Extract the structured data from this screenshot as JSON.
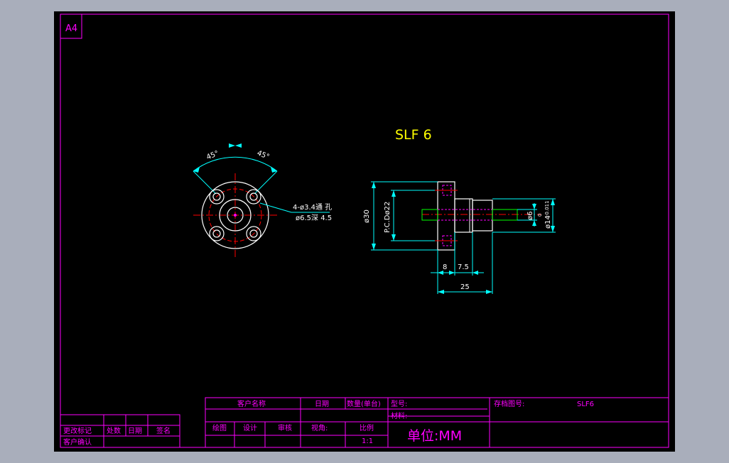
{
  "sheet": {
    "size_label": "A4"
  },
  "title": "SLF 6",
  "front_view": {
    "angle_left": "45°",
    "angle_right": "45°",
    "hole_note_line1": "4-ø3.4通 孔",
    "hole_note_line2": "ø6.5深 4.5"
  },
  "side_view": {
    "dim_outer_dia": "ø30",
    "dim_pcd": "P.C.Dø22",
    "dim_shaft_dia": "ø6",
    "dim_body_dia": "ø14",
    "dim_body_tol_upper": "0",
    "dim_body_tol_lower": "-0.011",
    "dim_flange": "8",
    "dim_step": "7.5",
    "dim_length": "25"
  },
  "title_block": {
    "customer_name_label": "客户名称",
    "date_label": "日期",
    "qty_label": "数量(单台)",
    "model_label": "型号:",
    "archive_label": "存档图号:",
    "archive_value": "SLF6",
    "material_label": "材料:",
    "drawn_label": "绘图",
    "design_label": "设计",
    "review_label": "审核",
    "view_label": "视角:",
    "scale_label": "比例",
    "scale_value": "1:1",
    "unit_label": "单位:MM"
  },
  "revision_block": {
    "change_mark": "更改标记",
    "location": "处数",
    "date": "日期",
    "signature": "签名",
    "customer_confirm": "客户确认"
  },
  "colors": {
    "border": "#ff00ff",
    "title": "#ffff00",
    "dimension": "#00ffff",
    "center": "#ff0000",
    "outline": "#ffffff",
    "hidden": "#ff00ff",
    "shaft": "#00ff00",
    "text_title_block": "#ff00ff"
  }
}
